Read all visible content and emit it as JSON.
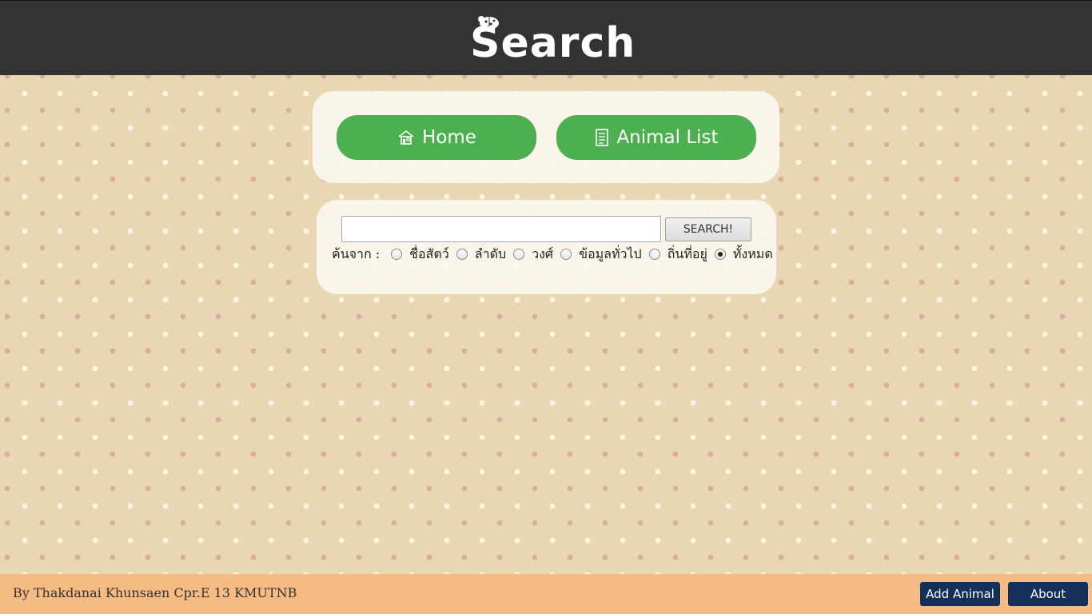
{
  "header": {
    "logo_text": "Search"
  },
  "nav": {
    "home_label": "Home",
    "animal_list_label": "Animal List"
  },
  "search": {
    "input_value": "",
    "button_label": "SEARCH!",
    "filter_prefix": "ค้นจาก :",
    "options": [
      {
        "label": "ชื่อสัตว์",
        "checked": false
      },
      {
        "label": "ลำดับ",
        "checked": false
      },
      {
        "label": "วงศ์",
        "checked": false
      },
      {
        "label": "ข้อมูลทั่วไป",
        "checked": false
      },
      {
        "label": "ถิ่นที่อยู่",
        "checked": false
      },
      {
        "label": "ทั้งหมด",
        "checked": true
      }
    ]
  },
  "footer": {
    "credit": "By Thakdanai Khunsaen Cpr.E 13 KMUTNB",
    "add_animal_label": "Add Animal",
    "about_label": "About"
  },
  "colors": {
    "header_bg": "#333333",
    "nav_button": "#4caf50",
    "footer_bg": "#f6bb82",
    "footer_button": "#14305a"
  }
}
